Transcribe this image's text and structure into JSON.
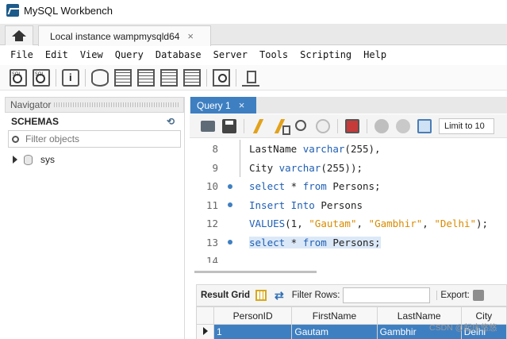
{
  "app": {
    "title": "MySQL Workbench",
    "accent": "#3e7fc1"
  },
  "tabs": {
    "home_icon": "home-icon",
    "instance_label": "Local instance wampmysqld64",
    "close_glyph": "×"
  },
  "menu": [
    "File",
    "Edit",
    "View",
    "Query",
    "Database",
    "Server",
    "Tools",
    "Scripting",
    "Help"
  ],
  "navigator": {
    "title": "Navigator",
    "schemas_label": "SCHEMAS",
    "filter_placeholder": "Filter objects",
    "schemas": [
      "sys"
    ]
  },
  "query_tab": {
    "label": "Query 1",
    "close_glyph": "×"
  },
  "sql_toolbar": {
    "limit_label": "Limit to 10"
  },
  "code_lines": [
    {
      "num": "8",
      "marker": false,
      "tokens": [
        [
          "",
          "LastName "
        ],
        [
          "kw",
          "varchar"
        ],
        [
          "",
          "(255),"
        ]
      ]
    },
    {
      "num": "9",
      "marker": false,
      "tokens": [
        [
          "",
          "City "
        ],
        [
          "kw",
          "varchar"
        ],
        [
          "",
          "(255));"
        ]
      ]
    },
    {
      "num": "10",
      "marker": true,
      "tokens": [
        [
          "kw",
          "select"
        ],
        [
          "",
          " * "
        ],
        [
          "kw",
          "from"
        ],
        [
          "",
          " Persons;"
        ]
      ]
    },
    {
      "num": "11",
      "marker": true,
      "tokens": [
        [
          "kw",
          "Insert Into"
        ],
        [
          "",
          " Persons"
        ]
      ]
    },
    {
      "num": "12",
      "marker": false,
      "tokens": [
        [
          "kw",
          "VALUES"
        ],
        [
          "",
          "(1, "
        ],
        [
          "str",
          "\"Gautam\""
        ],
        [
          "",
          ", "
        ],
        [
          "str",
          "\"Gambhir\""
        ],
        [
          "",
          ", "
        ],
        [
          "str",
          "\"Delhi\""
        ],
        [
          "",
          ");"
        ]
      ]
    },
    {
      "num": "13",
      "marker": true,
      "highlight": true,
      "tokens": [
        [
          "kw",
          "select"
        ],
        [
          "",
          " * "
        ],
        [
          "kw",
          "from"
        ],
        [
          "",
          " Persons;"
        ]
      ]
    },
    {
      "num": "14",
      "marker": false,
      "tokens": []
    }
  ],
  "result": {
    "grid_label": "Result Grid",
    "filter_label": "Filter Rows:",
    "export_label": "Export:",
    "columns": [
      "PersonID",
      "FirstName",
      "LastName",
      "City"
    ],
    "rows": [
      [
        "1",
        "Gautam",
        "Gambhir",
        "Delhi"
      ]
    ]
  },
  "watermark": "CSDN @起床悠悠"
}
